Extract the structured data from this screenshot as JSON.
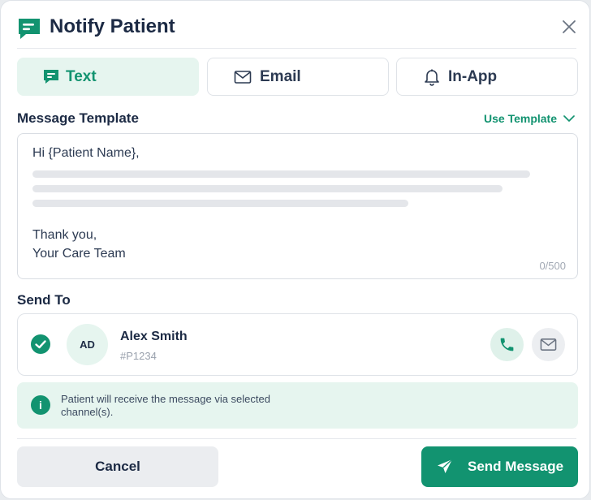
{
  "header": {
    "title": "Notify Patient"
  },
  "tabs": [
    {
      "label": "Text",
      "icon": "message-icon",
      "active": true
    },
    {
      "label": "Email",
      "icon": "mail-icon",
      "active": false
    },
    {
      "label": "In-App",
      "icon": "bell-icon",
      "active": false
    }
  ],
  "template": {
    "label": "Message Template",
    "use_template": "Use Template",
    "greeting": "Hi {Patient Name},",
    "signoff_1": "Thank you,",
    "signoff_2": "Your Care Team",
    "counter": "0/500"
  },
  "send_to": {
    "label": "Send To",
    "recipient": {
      "initials": "AD",
      "name": "Alex Smith",
      "id": "#P1234",
      "selected": true
    }
  },
  "info": {
    "text": "Patient will receive the message via selected channel(s)."
  },
  "footer": {
    "cancel": "Cancel",
    "send": "Send Message"
  },
  "colors": {
    "accent": "#129370",
    "accent_light": "#e6f5ef",
    "text": "#1c2a44"
  }
}
